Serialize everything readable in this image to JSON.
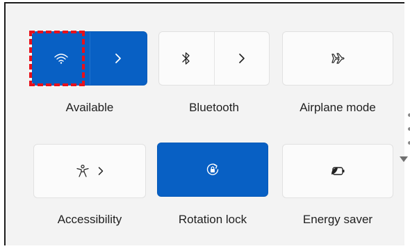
{
  "tiles": {
    "wifi": {
      "label": "Available",
      "icon": "wifi-icon",
      "state": "on"
    },
    "bluetooth": {
      "label": "Bluetooth",
      "icon": "bluetooth-icon",
      "state": "off"
    },
    "airplane": {
      "label": "Airplane mode",
      "icon": "airplane-icon",
      "state": "off"
    },
    "accessibility": {
      "label": "Accessibility",
      "icon": "accessibility-icon",
      "state": "off"
    },
    "rotation": {
      "label": "Rotation lock",
      "icon": "rotation-lock-icon",
      "state": "on"
    },
    "energy": {
      "label": "Energy saver",
      "icon": "energy-saver-icon",
      "state": "off"
    }
  },
  "colors": {
    "accent": "#0860c4",
    "tile_off": "#fbfbfb",
    "panel": "#f3f3f3",
    "highlight": "#e8101a"
  }
}
